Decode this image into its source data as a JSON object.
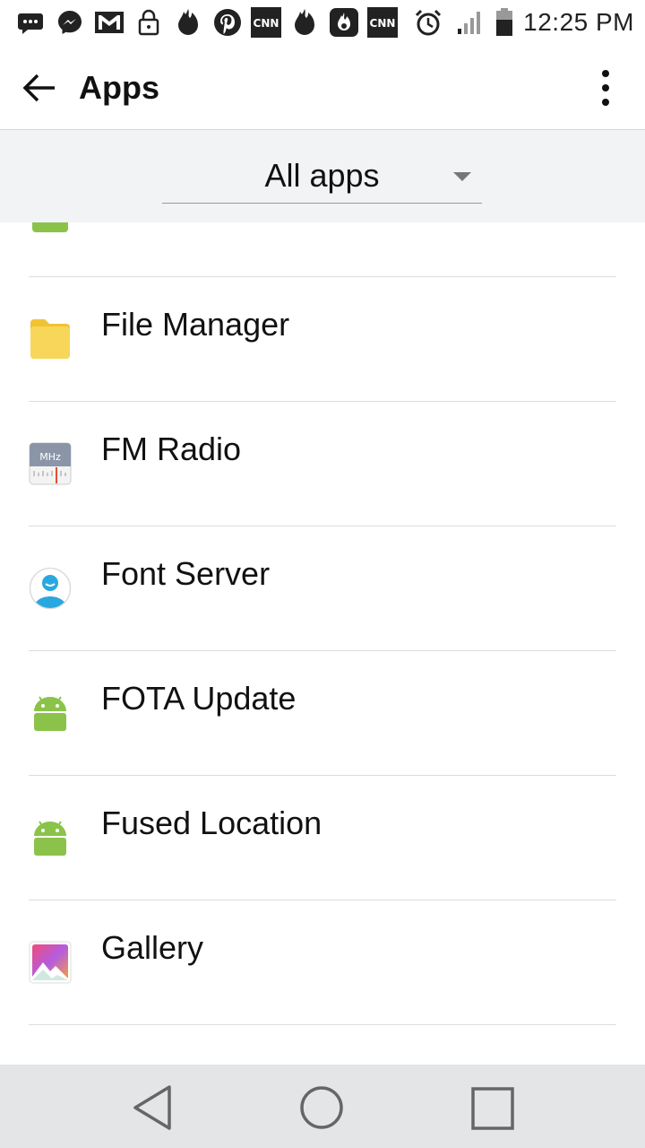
{
  "status_bar": {
    "time": "12:25 PM",
    "left_icons": [
      "more-icon",
      "messenger-icon",
      "gmail-icon",
      "lock-icon",
      "tinder-icon",
      "pinterest-icon",
      "cnn-icon",
      "tinder-icon",
      "hotspot-icon",
      "cnn-icon"
    ],
    "cnn_text": "CNN",
    "right_icons": [
      "alarm-icon",
      "signal-icon",
      "battery-icon"
    ]
  },
  "app_bar": {
    "title": "Apps"
  },
  "filter": {
    "selected": "All apps"
  },
  "apps": [
    {
      "name": "File Manager",
      "icon": "folder-icon"
    },
    {
      "name": "FM Radio",
      "icon": "radio-icon",
      "icon_text": "MHz"
    },
    {
      "name": "Font Server",
      "icon": "font-server-icon"
    },
    {
      "name": "FOTA Update",
      "icon": "android-icon"
    },
    {
      "name": "Fused Location",
      "icon": "android-icon"
    },
    {
      "name": "Gallery",
      "icon": "gallery-icon"
    }
  ],
  "colors": {
    "android_green": "#8bc34a",
    "folder_yellow": "#f7cf3b",
    "nav_bg": "#e4e5e7",
    "filter_bg": "#f2f3f4"
  }
}
